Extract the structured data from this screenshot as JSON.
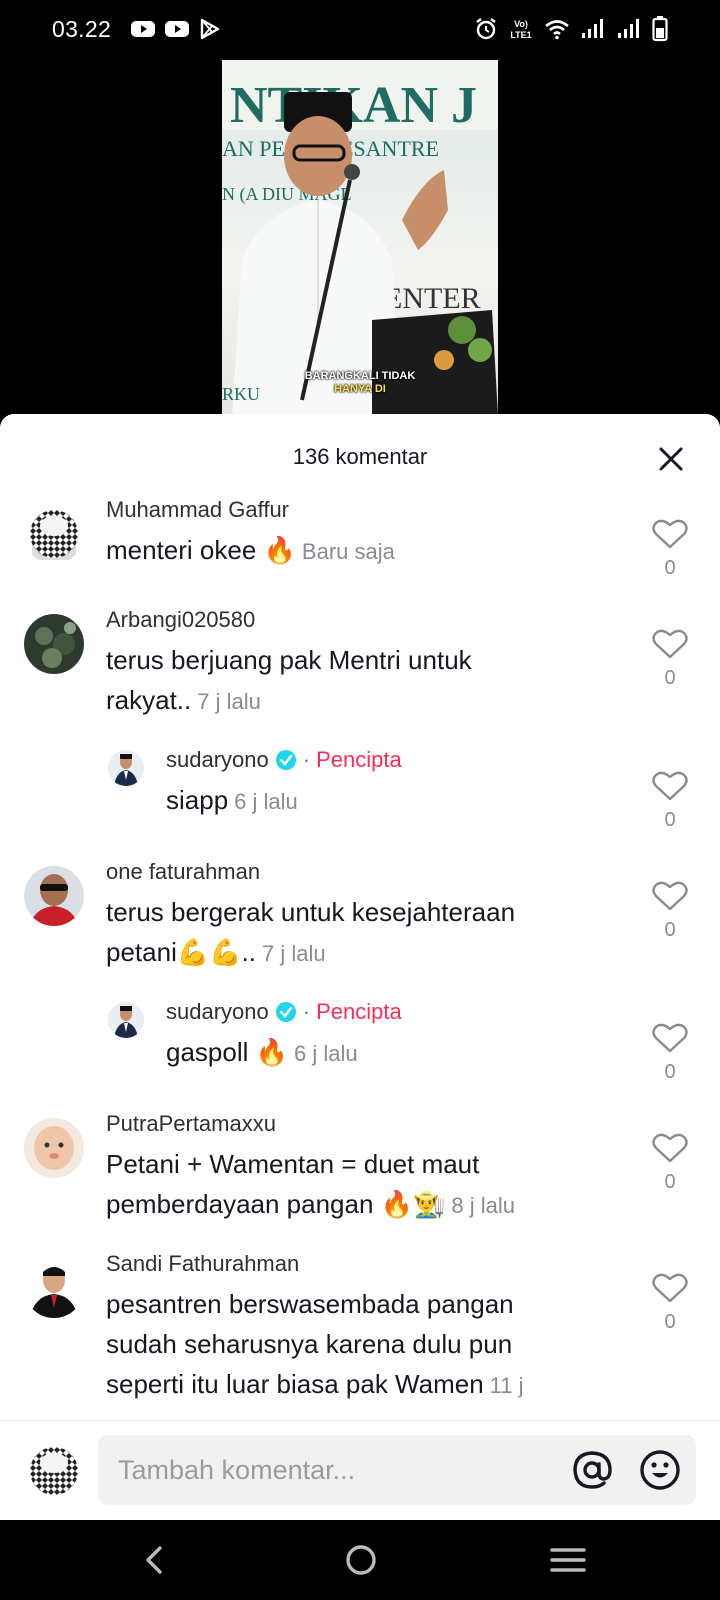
{
  "status_bar": {
    "time": "03.22",
    "network_label": "VoLTE1"
  },
  "video": {
    "subtitle_line1": "BARANGKALI TIDAK",
    "subtitle_line2": "HANYA DI"
  },
  "comments_sheet": {
    "title": "136 komentar",
    "comments": [
      {
        "username": "Muhammad Gaffur",
        "text": "menteri okee 🔥",
        "time": "Baru saja",
        "likes": "0"
      },
      {
        "username": "Arbangi020580",
        "text": "terus berjuang pak Mentri untuk rakyat..",
        "time": "7 j lalu",
        "likes": "0"
      },
      {
        "username": "sudaryono",
        "creator_label": "Pencipta",
        "separator": "·",
        "text": "siapp",
        "time": "6 j lalu",
        "likes": "0",
        "is_reply": true,
        "verified": true
      },
      {
        "username": "one faturahman",
        "text": "terus bergerak untuk kesejahteraan petani💪💪..",
        "time": "7 j lalu",
        "likes": "0"
      },
      {
        "username": "sudaryono",
        "creator_label": "Pencipta",
        "separator": "·",
        "text": "gaspoll 🔥",
        "time": "6 j lalu",
        "likes": "0",
        "is_reply": true,
        "verified": true
      },
      {
        "username": "PutraPertamaxxu",
        "text": "Petani + Wamentan = duet maut pemberdayaan pangan 🔥👨‍🌾",
        "time": "8 j lalu",
        "likes": "0"
      },
      {
        "username": "Sandi Fathurahman",
        "text": "pesantren berswasembada pangan sudah seharusnya karena dulu pun seperti itu luar biasa pak Wamen",
        "time": "11 j",
        "likes": "0"
      }
    ]
  },
  "input_bar": {
    "placeholder": "Tambah komentar..."
  },
  "icons": {
    "close": "close-icon",
    "heart": "heart-icon",
    "at": "at-icon",
    "emoji": "emoji-icon",
    "back": "back-icon",
    "home": "home-icon",
    "recents": "recents-icon"
  },
  "colors": {
    "creator": "#fe2c55",
    "verified": "#20d5ec",
    "text": "#161823",
    "muted": "#8a8b91"
  }
}
